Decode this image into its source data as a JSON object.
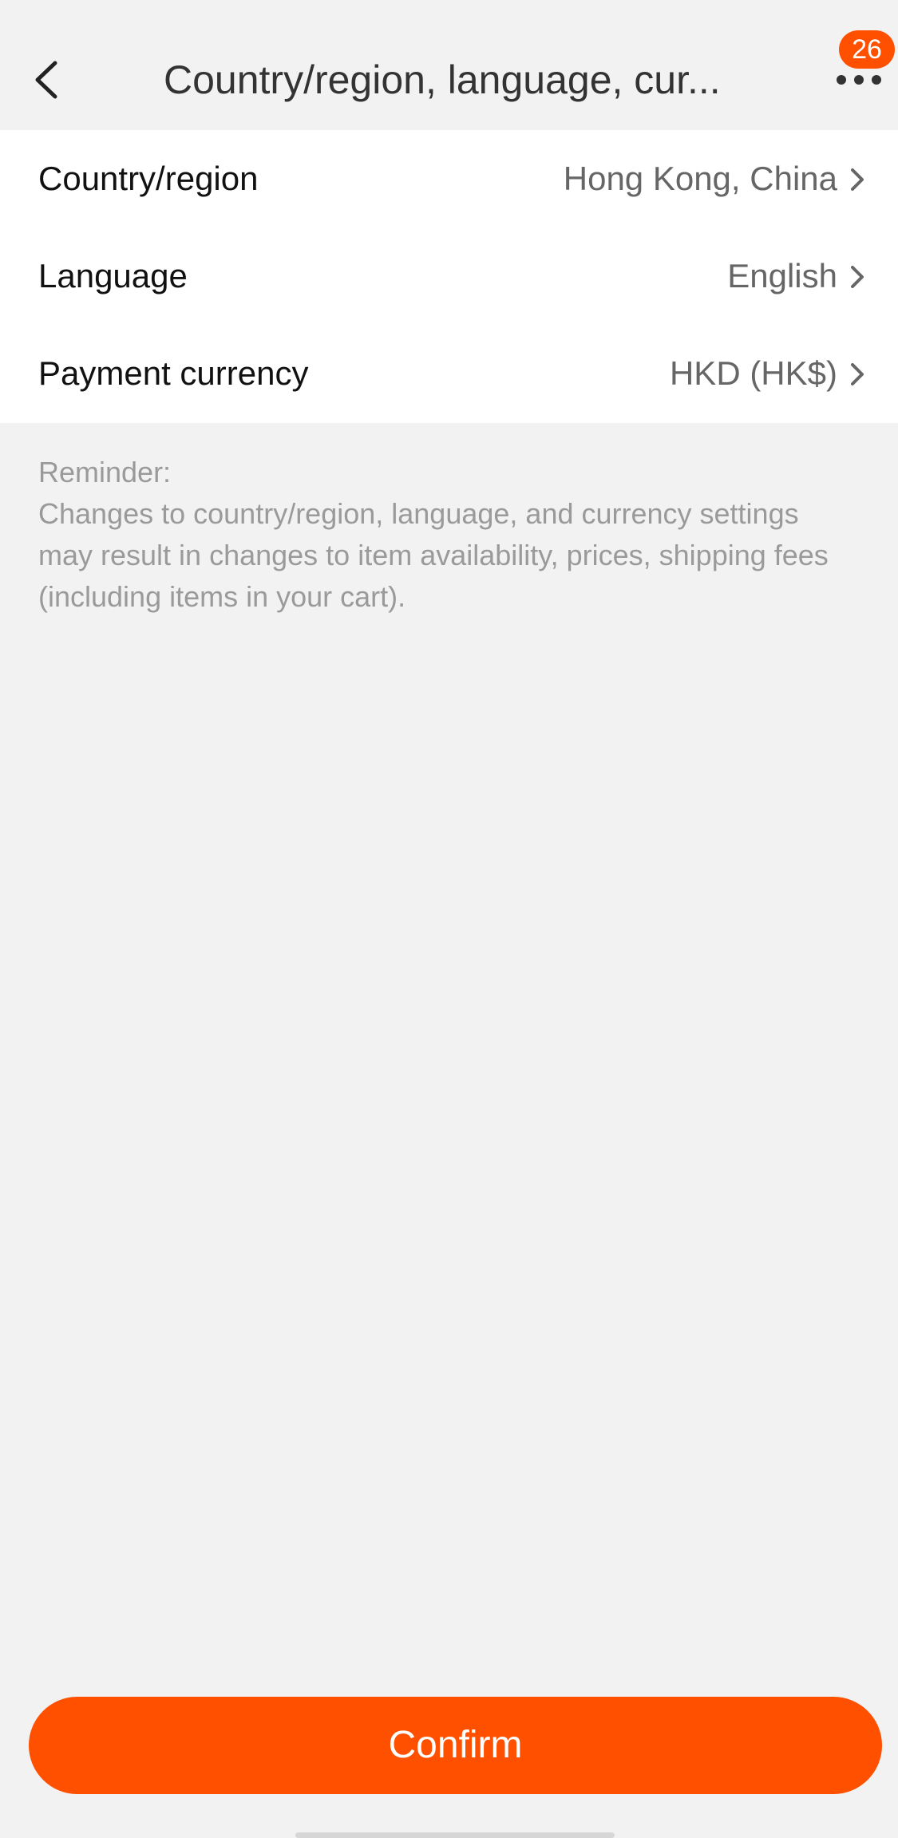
{
  "header": {
    "title": "Country/region, language, cur...",
    "notification_count": "26",
    "back_icon": "chevron-left-icon",
    "more_icon": "more-dots-icon"
  },
  "settings": {
    "rows": [
      {
        "label": "Country/region",
        "value": "Hong Kong, China"
      },
      {
        "label": "Language",
        "value": "English"
      },
      {
        "label": "Payment currency",
        "value": "HKD (HK$)"
      }
    ]
  },
  "reminder": {
    "heading": "Reminder:",
    "body": "Changes to country/region, language, and currency settings may result in changes to item availability, prices, shipping fees (including items in your cart)."
  },
  "footer": {
    "confirm_label": "Confirm"
  },
  "colors": {
    "accent": "#ff5000",
    "background": "#f2f2f2",
    "card": "#ffffff",
    "text_primary": "#111111",
    "text_secondary": "#666666",
    "text_muted": "#9a9a9a"
  }
}
